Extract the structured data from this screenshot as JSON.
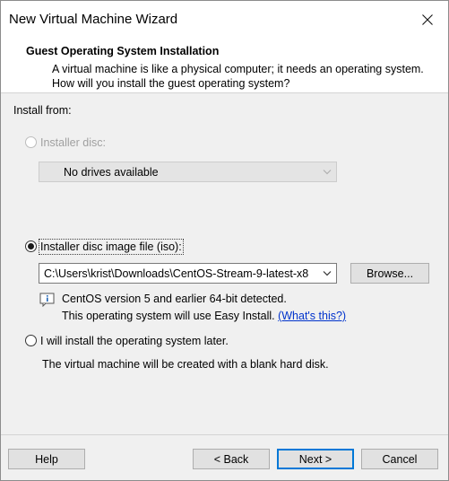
{
  "window": {
    "title": "New Virtual Machine Wizard"
  },
  "header": {
    "title": "Guest Operating System Installation",
    "description": "A virtual machine is like a physical computer; it needs an operating system. How will you install the guest operating system?"
  },
  "install_from_label": "Install from:",
  "installer_disc": {
    "label": "Installer disc:",
    "selected": false,
    "disabled": true,
    "dropdown_value": "No drives available"
  },
  "iso_option": {
    "label": "Installer disc image file (iso):",
    "selected": true,
    "path_value": "C:\\Users\\krist\\Downloads\\CentOS-Stream-9-latest-x8",
    "browse_label": "Browse...",
    "detect_line1": "CentOS version 5 and earlier 64-bit detected.",
    "detect_line2": "This operating system will use Easy Install.",
    "whats_this": "(What's this?)",
    "info_icon": "info-icon"
  },
  "later_option": {
    "label": "I will install the operating system later.",
    "selected": false,
    "description": "The virtual machine will be created with a blank hard disk."
  },
  "buttons": {
    "help": "Help",
    "back": "< Back",
    "next": "Next >",
    "cancel": "Cancel"
  },
  "colors": {
    "accent": "#0078d7",
    "link": "#0033cc",
    "disabled_text": "#a0a0a0"
  }
}
